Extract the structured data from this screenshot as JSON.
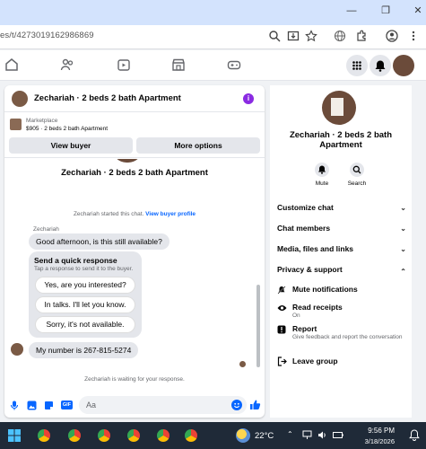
{
  "browser": {
    "url": "es/t/4273019162986869"
  },
  "chat": {
    "title": "Zechariah · 2 beds 2 bath Apartment",
    "marketplace_label": "Marketplace",
    "listing_line": "$905 · 2 beds 2 bath Apartment",
    "view_buyer_button": "View buyer",
    "more_options_button": "More options",
    "banner_title": "Zechariah · 2 beds 2 bath Apartment",
    "system_msg": "Zechariah started this chat.",
    "system_link": "View buyer profile",
    "sender_name": "Zechariah",
    "message_1": "Good afternoon, is this still available?",
    "quick_title": "Send a quick response",
    "quick_sub": "Tap a response to send it to the buyer.",
    "quick_responses": [
      "Yes, are you interested?",
      "In talks. I'll let you know.",
      "Sorry, it's not available."
    ],
    "message_2": "My number is 267-815-5274",
    "waiting_text": "Zechariah is waiting for your response.",
    "composer_placeholder": "Aa"
  },
  "info_panel": {
    "title": "Zechariah · 2 beds 2 bath Apartment",
    "mute_label": "Mute",
    "search_label": "Search",
    "sections": [
      "Customize chat",
      "Chat members",
      "Media, files and links",
      "Privacy & support"
    ],
    "mute_notifications": "Mute notifications",
    "read_receipts": "Read receipts",
    "read_receipts_status": "On",
    "report": "Report",
    "report_sub": "Give feedback and report the conversation",
    "leave_group": "Leave group"
  },
  "taskbar": {
    "temperature": "22°C",
    "time": "9:56 PM",
    "date": "3/18/2026"
  },
  "colors": {
    "accent": "#0866ff",
    "purple_badge": "#8a2be2",
    "taskbar": "#1f2a38"
  }
}
